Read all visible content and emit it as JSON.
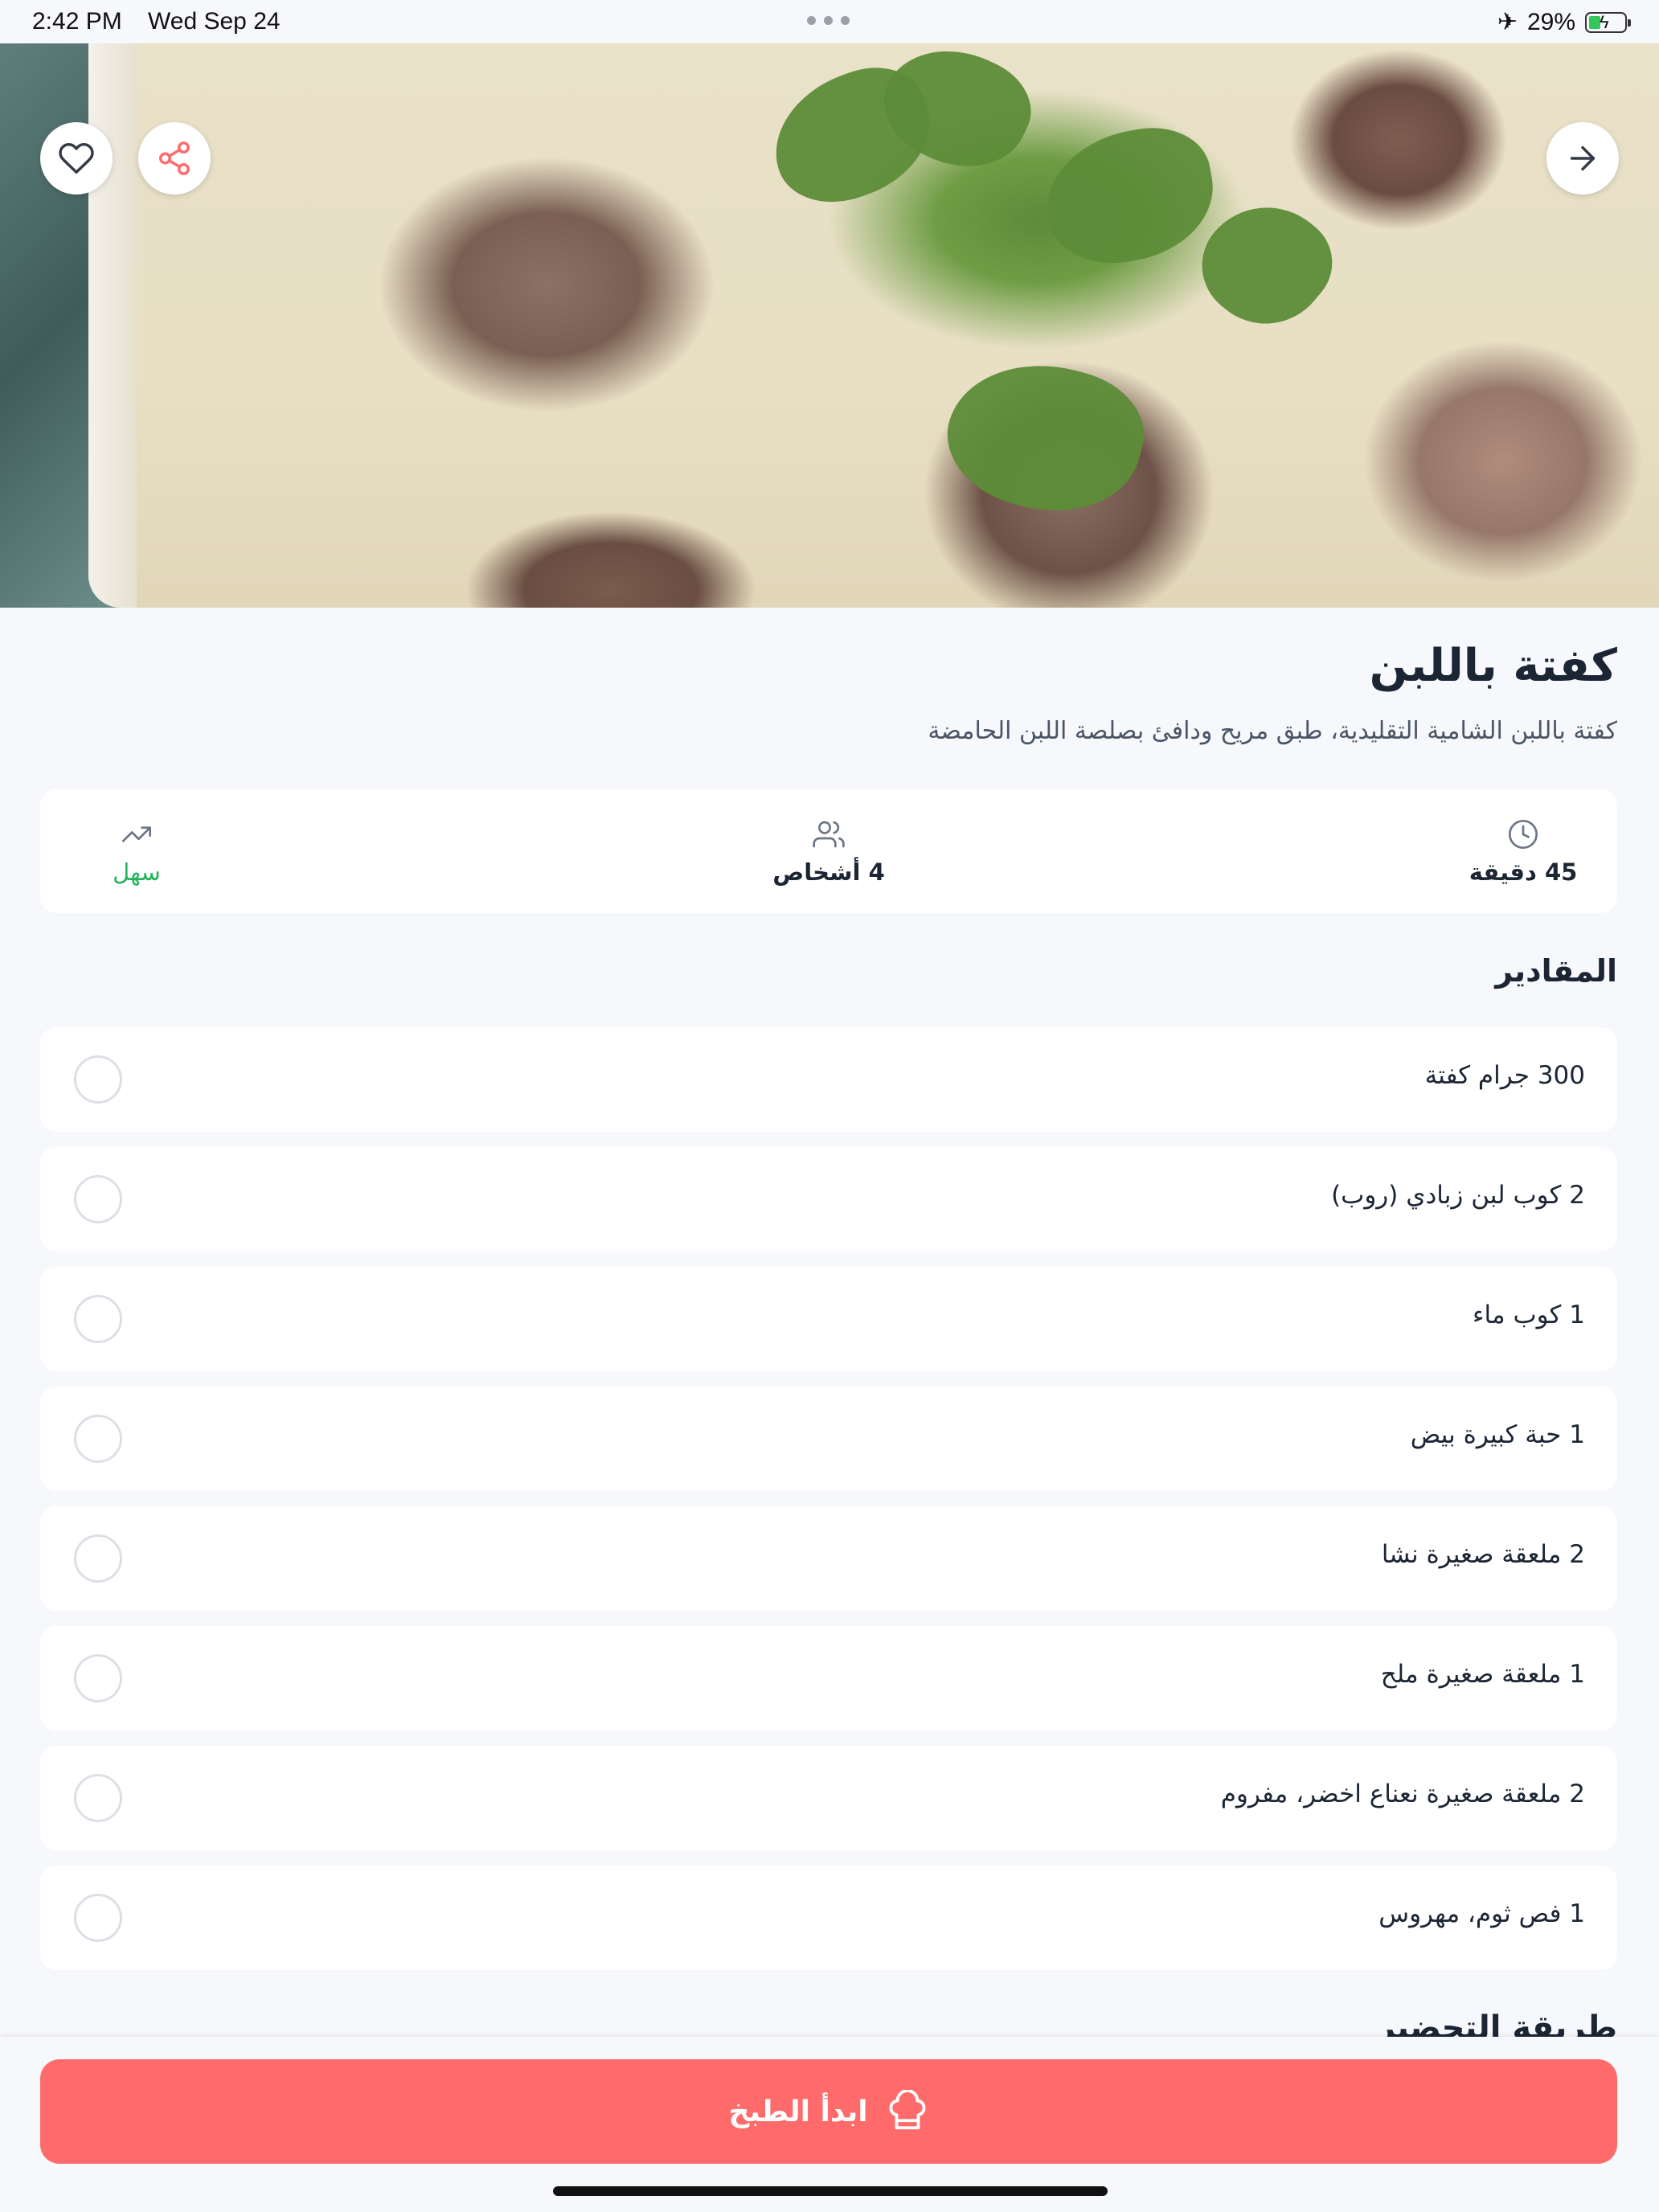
{
  "status_bar": {
    "time": "2:42 PM",
    "date": "Wed Sep 24",
    "battery_percent": "29%"
  },
  "recipe": {
    "title": "كفتة باللبن",
    "description": "كفتة باللبن الشامية التقليدية، طبق مريح ودافئ بصلصة اللبن الحامضة",
    "stats": {
      "time": "45 دقيقة",
      "servings": "4 أشخاص",
      "difficulty": "سهل"
    }
  },
  "ingredients": {
    "heading": "المقادير",
    "items": [
      "300 جرام كفتة",
      "2 كوب لبن زبادي (روب)",
      "1 كوب ماء",
      "1 حبة كبيرة بيض",
      "2 ملعقة صغيرة نشا",
      "1 ملعقة صغيرة ملح",
      "2 ملعقة صغيرة نعناع اخضر، مفروم",
      "1 فص ثوم، مهروس"
    ]
  },
  "next_section_heading": "طريقة التحضير",
  "actions": {
    "start_cooking": "ابدأ الطبخ"
  },
  "icons": {
    "favorite": "heart-icon",
    "share": "share-icon",
    "forward": "arrow-right-icon",
    "time": "clock-icon",
    "servings": "users-icon",
    "difficulty": "trending-up-icon",
    "cook": "chef-hat-icon"
  },
  "colors": {
    "accent": "#FF6B6B",
    "easy_green": "#22B35A",
    "background": "#F7F8FB"
  }
}
